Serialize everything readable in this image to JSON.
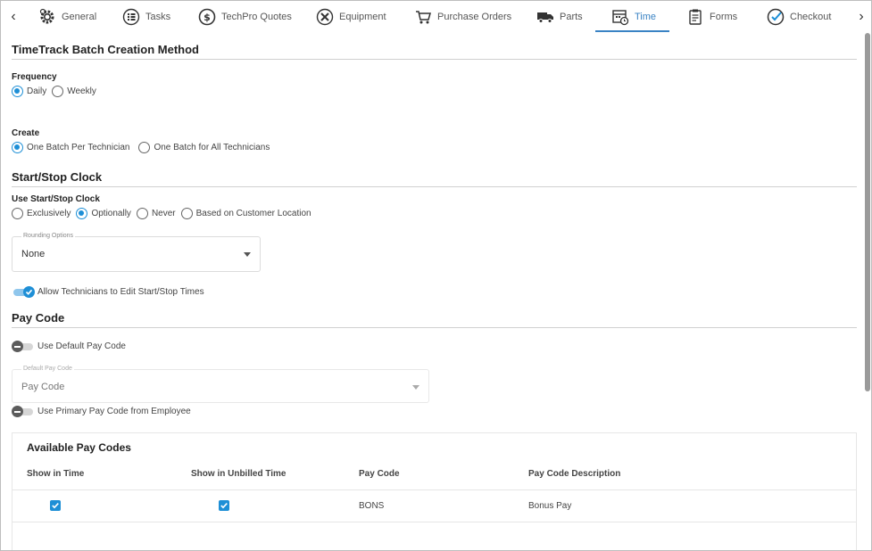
{
  "tabs": [
    {
      "label": "General",
      "icon": "gear-icon"
    },
    {
      "label": "Tasks",
      "icon": "list-icon"
    },
    {
      "label": "TechPro Quotes",
      "icon": "dollar-icon"
    },
    {
      "label": "Equipment",
      "icon": "tools-icon"
    },
    {
      "label": "Purchase Orders",
      "icon": "cart-icon"
    },
    {
      "label": "Parts",
      "icon": "truck-icon"
    },
    {
      "label": "Time",
      "icon": "calendar-clock-icon"
    },
    {
      "label": "Forms",
      "icon": "clipboard-icon"
    },
    {
      "label": "Checkout",
      "icon": "check-circle-icon"
    }
  ],
  "active_tab": "Time",
  "nav": {
    "prev": "‹",
    "next": "›"
  },
  "batch": {
    "title": "TimeTrack Batch Creation Method",
    "frequency_label": "Frequency",
    "frequency_options": [
      "Daily",
      "Weekly"
    ],
    "frequency_selected": "Daily",
    "create_label": "Create",
    "create_options": [
      "One Batch Per Technician",
      "One Batch for All Technicians"
    ],
    "create_selected": "One Batch Per Technician"
  },
  "clock": {
    "title": "Start/Stop Clock",
    "use_label": "Use Start/Stop Clock",
    "use_options": [
      "Exclusively",
      "Optionally",
      "Never",
      "Based on Customer Location"
    ],
    "use_selected": "Optionally",
    "rounding_legend": "Rounding Options",
    "rounding_value": "None",
    "allow_edit_label": "Allow Technicians to Edit Start/Stop Times",
    "allow_edit_on": true
  },
  "paycode": {
    "title": "Pay Code",
    "use_default_label": "Use Default Pay Code",
    "use_default_on": false,
    "default_legend": "Default Pay Code",
    "default_placeholder": "Pay Code",
    "use_primary_label": "Use Primary Pay Code from Employee",
    "use_primary_on": false
  },
  "available": {
    "title": "Available Pay Codes",
    "columns": [
      "Show in Time",
      "Show in Unbilled Time",
      "Pay Code",
      "Pay Code Description"
    ],
    "rows": [
      {
        "show_in_time": true,
        "show_in_unbilled": true,
        "code": "BONS",
        "description": "Bonus Pay"
      }
    ]
  },
  "colors": {
    "accent": "#1e8fd6",
    "tab_active": "#3a83c4"
  }
}
